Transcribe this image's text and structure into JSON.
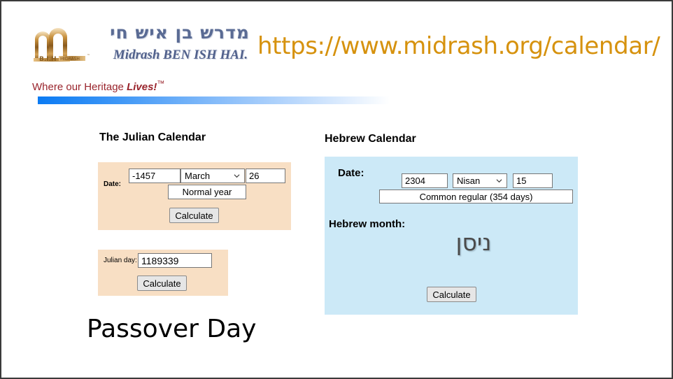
{
  "header": {
    "logo_icon": "midrash-archway-logo",
    "hebrew_brand": "מדרש בן איש חי",
    "latin_brand": "Midrash BEN ISH HAI.",
    "url": "https://www.midrash.org/calendar/",
    "tagline_prefix": "Where our Heritage ",
    "tagline_emphasis": "Lives!",
    "tagline_tm": "™",
    "colors": {
      "url": "#d6920e",
      "tagline": "#99232b",
      "brand": "#51618c",
      "gradient_start": "#0b7bf3",
      "gradient_end": "#ffffff"
    }
  },
  "julian": {
    "heading": "The Julian Calendar",
    "panel_color": "#f8dfc4",
    "date_label": "Date:",
    "year_value": "-1457",
    "month_value": "March",
    "day_value": "26",
    "year_type": "Normal year",
    "calculate_label": "Calculate",
    "julian_day_label": "Julian day:",
    "julian_day_value": "1189339",
    "julian_day_calculate_label": "Calculate"
  },
  "hebrew": {
    "heading": "Hebrew Calendar",
    "panel_color": "#cce9f7",
    "date_label": "Date:",
    "year_value": "2304",
    "month_value": "Nisan",
    "day_value": "15",
    "year_type": "Common regular (354 days)",
    "month_label": "Hebrew month:",
    "month_hebrew_value": "ניסן",
    "calculate_label": "Calculate"
  },
  "caption": {
    "text": "Passover Day"
  }
}
